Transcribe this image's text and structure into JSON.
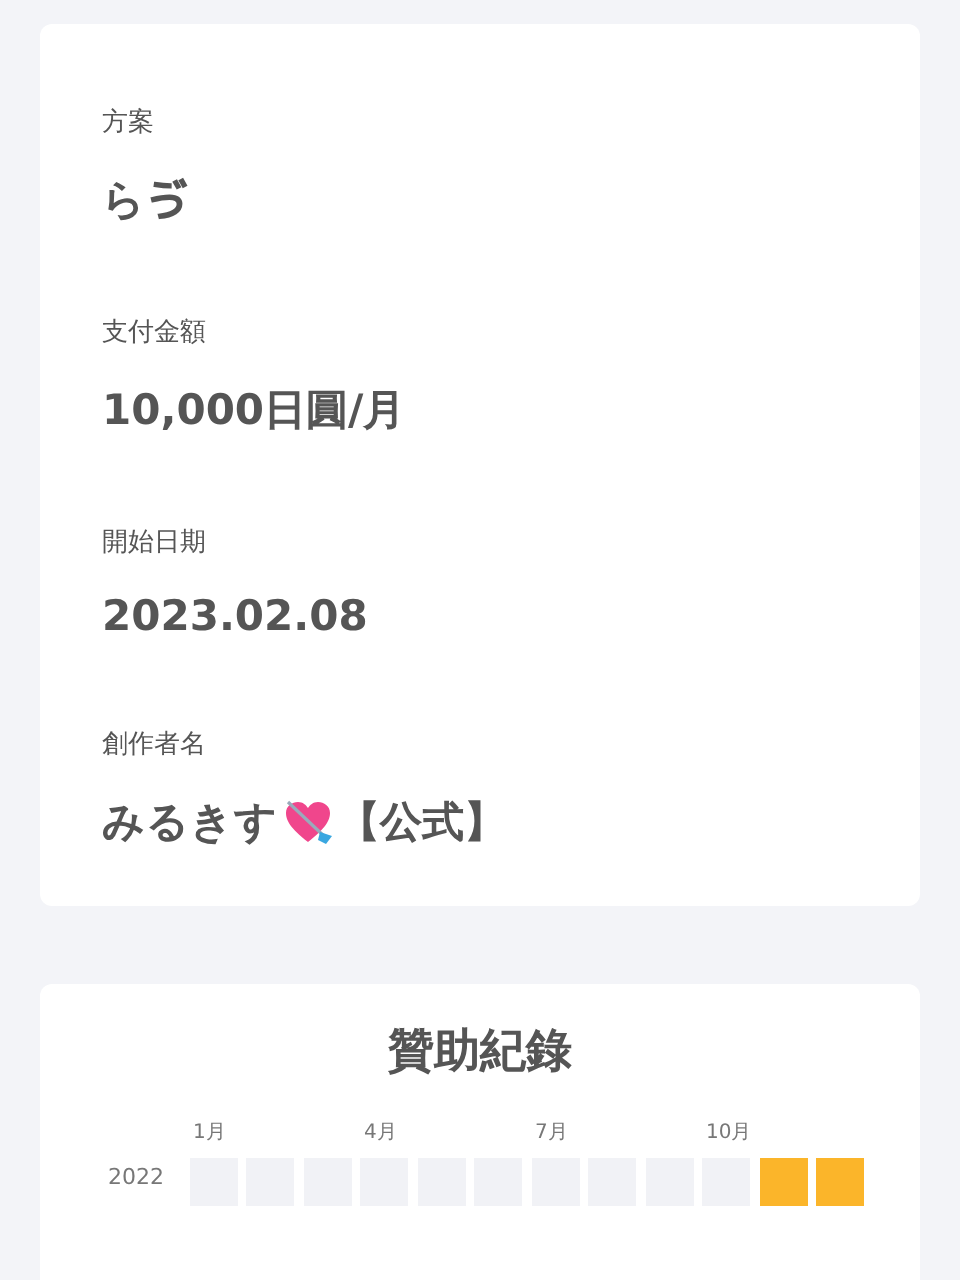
{
  "details": [
    {
      "label": "方案",
      "value": "らゔ"
    },
    {
      "label": "支付金額",
      "value": "10,000日圓/月"
    },
    {
      "label": "開始日期",
      "value": "2023.02.08"
    },
    {
      "label": "創作者名",
      "value": "みるきす",
      "suffix": "【公式】",
      "kind": "creator"
    }
  ],
  "sponsor_history": {
    "title": "贊助紀錄",
    "month_markers": [
      "1月",
      "4月",
      "7月",
      "10月"
    ],
    "years": [
      {
        "year": "2022",
        "months": [
          {
            "active": false
          },
          {
            "active": false
          },
          {
            "active": false
          },
          {
            "active": false
          },
          {
            "active": false
          },
          {
            "active": false
          },
          {
            "active": false
          },
          {
            "active": false
          },
          {
            "active": false
          },
          {
            "active": false
          },
          {
            "active": true
          },
          {
            "active": true
          }
        ]
      }
    ]
  }
}
